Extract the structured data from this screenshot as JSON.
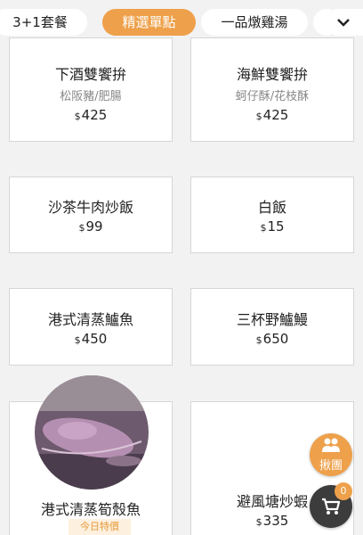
{
  "tabs": [
    {
      "label": "3+1套餐",
      "active": false
    },
    {
      "label": "精選單點",
      "active": true
    },
    {
      "label": "一品燉雞湯",
      "active": false
    }
  ],
  "more_icon": "chevron-down-icon",
  "items": [
    {
      "name": "下酒雙饗拚",
      "sub": "松阪豬/肥腸",
      "currency": "$",
      "price": "425"
    },
    {
      "name": "海鮮雙饗拚",
      "sub": "蚵仔酥/花枝酥",
      "currency": "$",
      "price": "425"
    },
    {
      "name": "沙茶牛肉炒飯",
      "currency": "$",
      "price": "99"
    },
    {
      "name": "白飯",
      "currency": "$",
      "price": "15"
    },
    {
      "name": "港式清蒸鱸魚",
      "currency": "$",
      "price": "450"
    },
    {
      "name": "三杯野鱸鰻",
      "currency": "$",
      "price": "650"
    },
    {
      "name": "港式清蒸筍殼魚",
      "badge": "今日特價"
    },
    {
      "name": "避風塘炒蝦",
      "currency": "$",
      "price": "335"
    }
  ],
  "group_button": {
    "label": "揪團",
    "icon": "group-icon"
  },
  "cart": {
    "count": "0",
    "icon": "cart-icon"
  },
  "colors": {
    "accent": "#eea04a",
    "background": "#f2f2f2",
    "card_border": "#d6d6d6",
    "cart": "#3c3c3c"
  }
}
